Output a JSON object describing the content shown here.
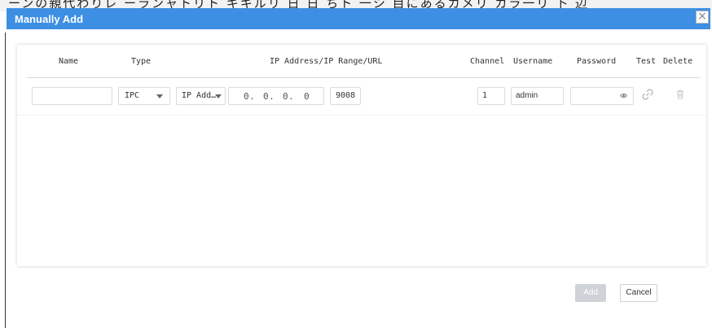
{
  "background": {
    "cropped_text": "ーンの親代わりレ  ーランャトリト キキルリ 日 日 ちト 一シ 目にあるカメリ カラ一リ 卜 辺"
  },
  "dialog": {
    "title": "Manually Add",
    "close_glyph": "×",
    "accent_color": "#3d8fe3"
  },
  "table": {
    "headers": {
      "name": "Name",
      "type": "Type",
      "ip": "IP Address/IP Range/URL",
      "channel": "Channel",
      "username": "Username",
      "password": "Password",
      "test": "Test",
      "delete": "Delete"
    },
    "rows": [
      {
        "name_value": "",
        "type_value": "IPC",
        "address_mode": "IP Add…",
        "ip_octets": [
          "0.",
          "0.",
          "0.",
          "0"
        ],
        "port": "9008",
        "channel": "1",
        "username": "admin",
        "password": "",
        "password_icon": "eye-icon",
        "test_icon": "link-icon",
        "delete_icon": "trash-icon"
      }
    ]
  },
  "footer": {
    "add_label": "Add",
    "cancel_label": "Cancel"
  }
}
